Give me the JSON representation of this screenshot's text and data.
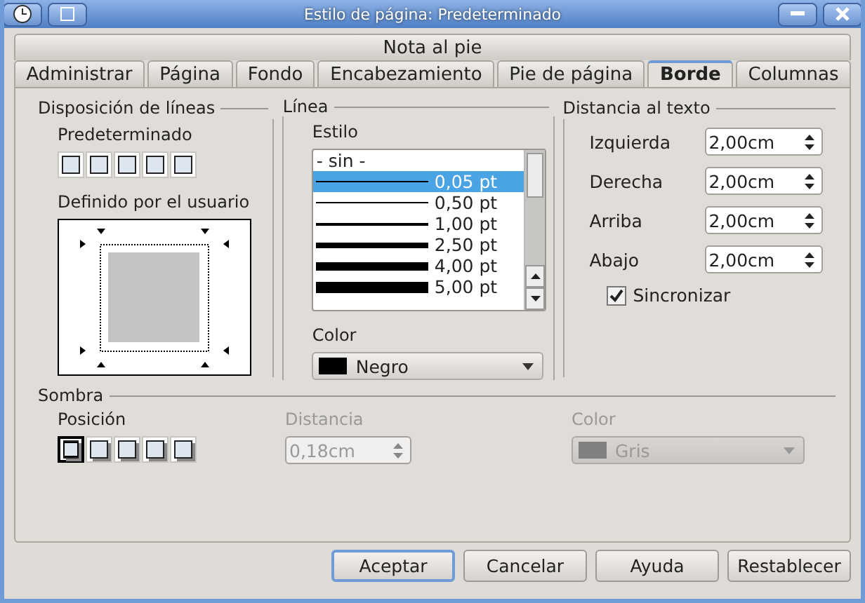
{
  "window": {
    "title": "Estilo de página: Predeterminado"
  },
  "tabs_back": [
    {
      "label": "Nota al pie",
      "selected": false
    }
  ],
  "tabs": [
    {
      "label": "Administrar",
      "selected": false
    },
    {
      "label": "Página",
      "selected": false
    },
    {
      "label": "Fondo",
      "selected": false
    },
    {
      "label": "Encabezamiento",
      "selected": false
    },
    {
      "label": "Pie de página",
      "selected": false
    },
    {
      "label": "Borde",
      "selected": true
    },
    {
      "label": "Columnas",
      "selected": false
    }
  ],
  "line_arrangement": {
    "title": "Disposición de líneas",
    "default_label": "Predeterminado",
    "presets": [
      {
        "selected": false
      },
      {
        "selected": false
      },
      {
        "selected": false
      },
      {
        "selected": false
      },
      {
        "selected": false
      }
    ],
    "user_label": "Definido por el usuario"
  },
  "line": {
    "title": "Línea",
    "style_label": "Estilo",
    "styles": [
      {
        "label": "- sin -",
        "kind": "none",
        "selected": false
      },
      {
        "label": "0,05 pt",
        "kind": "hairline",
        "selected": true
      },
      {
        "label": "0,50 pt",
        "kind": "thin",
        "selected": false
      },
      {
        "label": "1,00 pt",
        "kind": "medium",
        "selected": false
      },
      {
        "label": "2,50 pt",
        "kind": "heavy",
        "selected": false
      },
      {
        "label": "4,00 pt",
        "kind": "bold",
        "selected": false
      },
      {
        "label": "5,00 pt",
        "kind": "max",
        "selected": false
      }
    ],
    "color_label": "Color",
    "color_value": "Negro",
    "color": "#000000"
  },
  "spacing": {
    "title": "Distancia al texto",
    "fields": [
      {
        "label": "Izquierda",
        "value": "2,00cm"
      },
      {
        "label": "Derecha",
        "value": "2,00cm"
      },
      {
        "label": "Arriba",
        "value": "2,00cm"
      },
      {
        "label": "Abajo",
        "value": "2,00cm"
      }
    ],
    "sync": {
      "label": "Sincronizar",
      "checked": true
    }
  },
  "shadow": {
    "title": "Sombra",
    "position_label": "Posición",
    "positions": [
      {
        "selected": true
      },
      {
        "selected": false
      },
      {
        "selected": false
      },
      {
        "selected": false
      },
      {
        "selected": false
      }
    ],
    "distance": {
      "label": "Distancia",
      "value": "0,18cm",
      "disabled": true
    },
    "color": {
      "label": "Color",
      "value": "Gris",
      "color": "#808080",
      "disabled": true
    }
  },
  "buttons": [
    {
      "label": "Aceptar",
      "default": true
    },
    {
      "label": "Cancelar",
      "default": false
    },
    {
      "label": "Ayuda",
      "default": false
    },
    {
      "label": "Restablecer",
      "default": false
    }
  ]
}
